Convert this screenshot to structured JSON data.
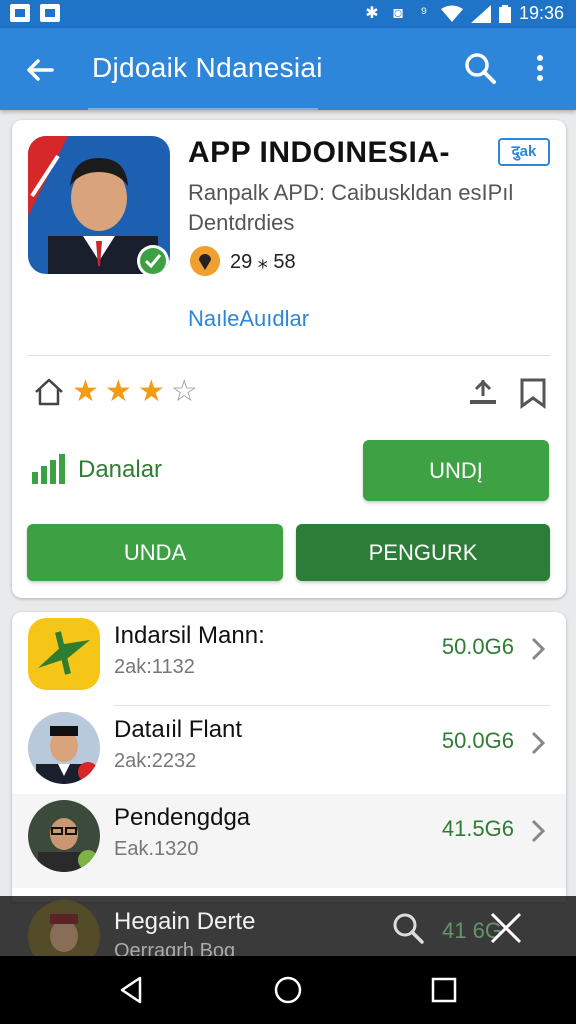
{
  "status_bar": {
    "time": "19:36"
  },
  "app_bar": {
    "title": "Djdoaik Ndanesiai"
  },
  "app_card": {
    "name": "APP INDOINESIA-",
    "badge": "दुak",
    "subtitle_line1": "Ranpalk APD: Caibuskldan esIPıl",
    "subtitle_line2": "Dentdrdies",
    "meta_value": "29 ⁎ 58",
    "developer": "NaıleAuıdlar",
    "rating": {
      "filled": 3,
      "total": 4
    },
    "downloads_label": "Danalar",
    "install_button": "UNDĮ",
    "button_left": "UNDA",
    "button_right": "PENGURK"
  },
  "list_items": [
    {
      "name": "Indarsil Mann:",
      "sub": "2ak:1132",
      "price": "50.0G6"
    },
    {
      "name": "Dataıil Flant",
      "sub": "2ak:2232",
      "price": "50.0G6"
    },
    {
      "name": "Pendengdga",
      "sub": "Eak.1320",
      "price": "41.5G6"
    }
  ],
  "overlay_item": {
    "name": "Hegain Derte",
    "sub": "Oerragrh Bog",
    "price": "41 6G"
  },
  "colors": {
    "primary": "#2d86d9",
    "status_bar": "#1f74c8",
    "green": "#3da043",
    "dark_green": "#2c7d37",
    "star": "#f39c12"
  },
  "icons": [
    "back-arrow-icon",
    "search-icon",
    "more-vert-icon",
    "map-pin-icon",
    "home-outline-icon",
    "download-icon",
    "bookmark-icon",
    "bar-chart-icon",
    "chevron-right-icon",
    "close-icon",
    "nav-back-icon",
    "nav-home-icon",
    "nav-recents-icon"
  ]
}
